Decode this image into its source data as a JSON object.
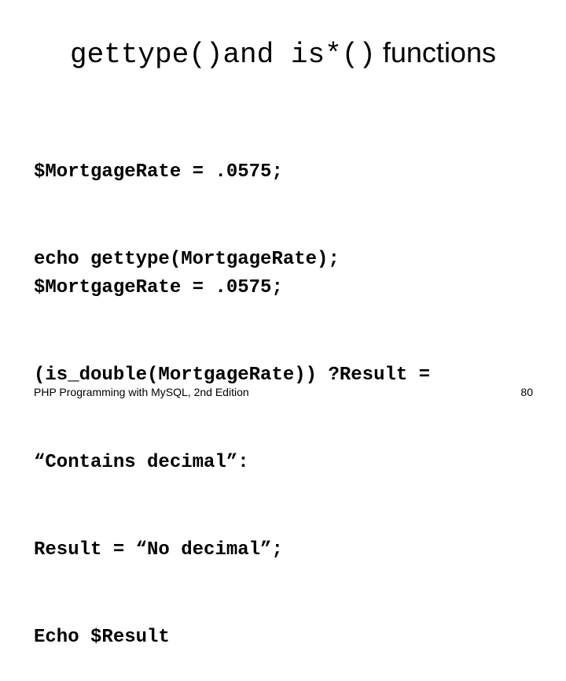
{
  "slide": {
    "title": {
      "code_part": "gettype()and is*()",
      "text_part": "functions"
    },
    "code_blocks": [
      {
        "lines": [
          "$MortgageRate = .0575;",
          "echo gettype(MortgageRate);"
        ]
      },
      {
        "lines": [
          "$MortgageRate = .0575;",
          "(is_double(MortgageRate)) ?Result =",
          "“Contains decimal”:",
          "Result = “No decimal”;",
          "Echo $Result"
        ]
      }
    ],
    "footer": {
      "book_title": "PHP Programming with MySQL, 2nd Edition",
      "page_number": "80"
    }
  }
}
